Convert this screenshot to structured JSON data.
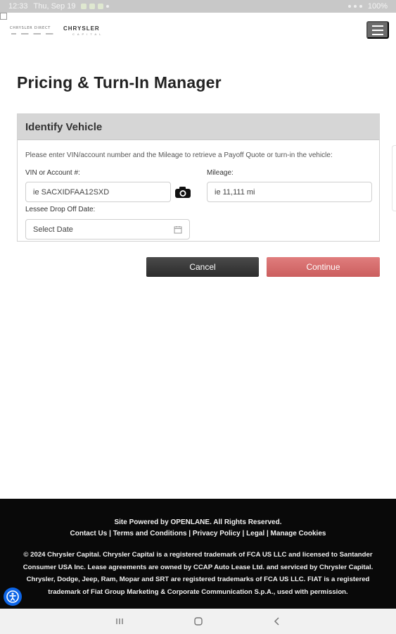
{
  "status_bar": {
    "time": "12:33",
    "date": "Thu, Sep 19",
    "battery": "100%"
  },
  "header": {
    "brand_small": "CHRYSLER DIRECT",
    "brand_main": "CHRYSLER",
    "brand_sub": "CAPITAL",
    "menu_icon": "hamburger-icon"
  },
  "page": {
    "title": "Pricing & Turn-In Manager"
  },
  "identify_vehicle": {
    "header": "Identify Vehicle",
    "instruction": "Please enter VIN/account number and the Mileage to retrieve a Payoff Quote or turn-in the vehicle:",
    "vin_label": "VIN or Account #:",
    "vin_placeholder": "ie SACXIDFAA12SXD",
    "mileage_label": "Mileage:",
    "mileage_placeholder": "ie 11,111 mi",
    "dropoff_label": "Lessee Drop Off Date:",
    "date_placeholder": "Select Date",
    "camera_icon": "camera-icon",
    "calendar_icon": "calendar-icon"
  },
  "actions": {
    "cancel": "Cancel",
    "continue": "Continue"
  },
  "footer": {
    "powered_by": "Site Powered by OPENLANE. All Rights Reserved.",
    "links": [
      "Contact Us",
      "Terms and Conditions",
      "Privacy Policy",
      "Legal",
      "Manage Cookies"
    ],
    "separator": " | ",
    "legal": "© 2024 Chrysler Capital. Chrysler Capital is a registered trademark of FCA US LLC and licensed to Santander Consumer USA Inc. Lease agreements are owned by CCAP Auto Lease Ltd. and serviced by Chrysler Capital. Chrysler, Dodge, Jeep, Ram, Mopar and SRT are registered trademarks of FCA US LLC. FIAT is a registered trademark of Fiat Group Marketing & Corporate Communication S.p.A., used with permission."
  },
  "colors": {
    "primary_dark": "#2c2c2c",
    "continue_button": "#cb5e5e",
    "footer_bg": "#090909",
    "accessibility_blue": "#0d65e7"
  }
}
